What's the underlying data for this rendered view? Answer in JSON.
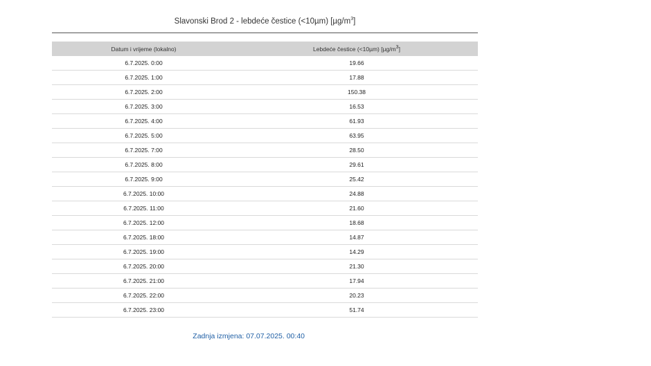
{
  "title": {
    "text": "Slavonski Brod 2 - lebdeće čestice (<10µm) [µg/m",
    "sup": "3",
    "close": "]"
  },
  "table": {
    "headers": {
      "datetime": "Datum i vrijeme (lokalno)",
      "value_text": "Lebdeće čestice (<10µm) [µg/m",
      "value_sup": "3",
      "value_close": "]"
    },
    "rows": [
      {
        "datetime": "6.7.2025. 0:00",
        "value": "19.66"
      },
      {
        "datetime": "6.7.2025. 1:00",
        "value": "17.88"
      },
      {
        "datetime": "6.7.2025. 2:00",
        "value": "150.38"
      },
      {
        "datetime": "6.7.2025. 3:00",
        "value": "16.53"
      },
      {
        "datetime": "6.7.2025. 4:00",
        "value": "61.93"
      },
      {
        "datetime": "6.7.2025. 5:00",
        "value": "63.95"
      },
      {
        "datetime": "6.7.2025. 7:00",
        "value": "28.50"
      },
      {
        "datetime": "6.7.2025. 8:00",
        "value": "29.61"
      },
      {
        "datetime": "6.7.2025. 9:00",
        "value": "25.42"
      },
      {
        "datetime": "6.7.2025. 10:00",
        "value": "24.88"
      },
      {
        "datetime": "6.7.2025. 11:00",
        "value": "21.60"
      },
      {
        "datetime": "6.7.2025. 12:00",
        "value": "18.68"
      },
      {
        "datetime": "6.7.2025. 18:00",
        "value": "14.87"
      },
      {
        "datetime": "6.7.2025. 19:00",
        "value": "14.29"
      },
      {
        "datetime": "6.7.2025. 20:00",
        "value": "21.30"
      },
      {
        "datetime": "6.7.2025. 21:00",
        "value": "17.94"
      },
      {
        "datetime": "6.7.2025. 22:00",
        "value": "20.23"
      },
      {
        "datetime": "6.7.2025. 23:00",
        "value": "51.74"
      }
    ]
  },
  "footer": {
    "last_modified": "Zadnja izmjena: 07.07.2025. 00:40"
  },
  "colors": {
    "header_bg": "#d3d3d3",
    "link_blue": "#1f5fa5"
  }
}
